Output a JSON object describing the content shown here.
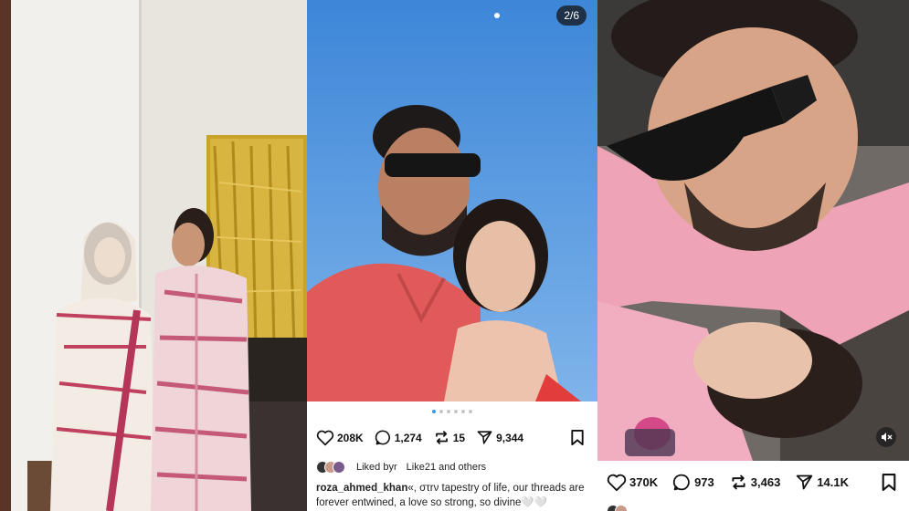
{
  "post1": {},
  "post2": {
    "counter": "2/6",
    "likes": "208K",
    "comments": "1,274",
    "reposts": "15",
    "shares": "9,344",
    "liked_by_text": "Liked by",
    "liked_by_suffix": "r",
    "others_text": "Like21 and others",
    "caption_user": "roza_ahmed_khan",
    "caption_text": "«, στrν tapestry of life, our threads are forever entwined, a love so strong, so divine",
    "caption_tail": "🤍🤍"
  },
  "post3": {
    "likes": "370K",
    "comments": "973",
    "reposts": "3,463",
    "shares": "14.1K"
  },
  "icons": {
    "like": "heart-icon",
    "comment": "comment-bubble-icon",
    "repost": "repost-icon",
    "share": "send-icon",
    "save": "bookmark-icon",
    "mute": "mute-icon"
  }
}
